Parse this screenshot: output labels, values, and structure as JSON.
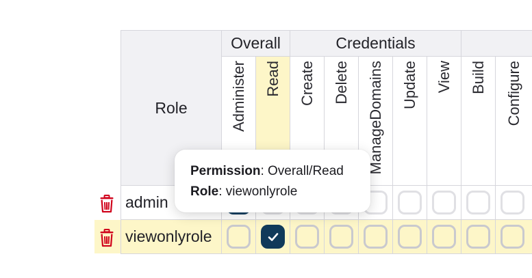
{
  "table": {
    "role_header": "Role",
    "groups": [
      {
        "label": "Overall"
      },
      {
        "label": "Credentials"
      },
      {
        "label": ""
      }
    ],
    "permissions": [
      {
        "label": "Administer",
        "group": "Overall",
        "highlighted": false
      },
      {
        "label": "Read",
        "group": "Overall",
        "highlighted": true
      },
      {
        "label": "Create",
        "group": "Credentials",
        "highlighted": false
      },
      {
        "label": "Delete",
        "group": "Credentials",
        "highlighted": false
      },
      {
        "label": "ManageDomains",
        "group": "Credentials",
        "highlighted": false
      },
      {
        "label": "Update",
        "group": "Credentials",
        "highlighted": false
      },
      {
        "label": "View",
        "group": "Credentials",
        "highlighted": false
      },
      {
        "label": "Build",
        "group": "",
        "highlighted": false
      },
      {
        "label": "Configure",
        "group": "",
        "highlighted": false
      }
    ],
    "rows": [
      {
        "role": "admin",
        "highlighted": false,
        "checked": [
          true,
          false,
          false,
          false,
          false,
          false,
          false,
          false,
          false
        ]
      },
      {
        "role": "viewonlyrole",
        "highlighted": true,
        "checked": [
          false,
          true,
          false,
          false,
          false,
          false,
          false,
          false,
          false
        ]
      }
    ]
  },
  "tooltip": {
    "permission_label": "Permission",
    "permission_value": ": Overall/Read",
    "role_label": "Role",
    "role_value": ": viewonlyrole"
  },
  "icons": {
    "delete": "trash-icon",
    "check": "checkmark-icon"
  },
  "colors": {
    "delete_icon": "#d0021b",
    "checked_box": "#103a5a",
    "row_highlight": "#fdf6c8",
    "header_bg": "#f1f1f4"
  }
}
